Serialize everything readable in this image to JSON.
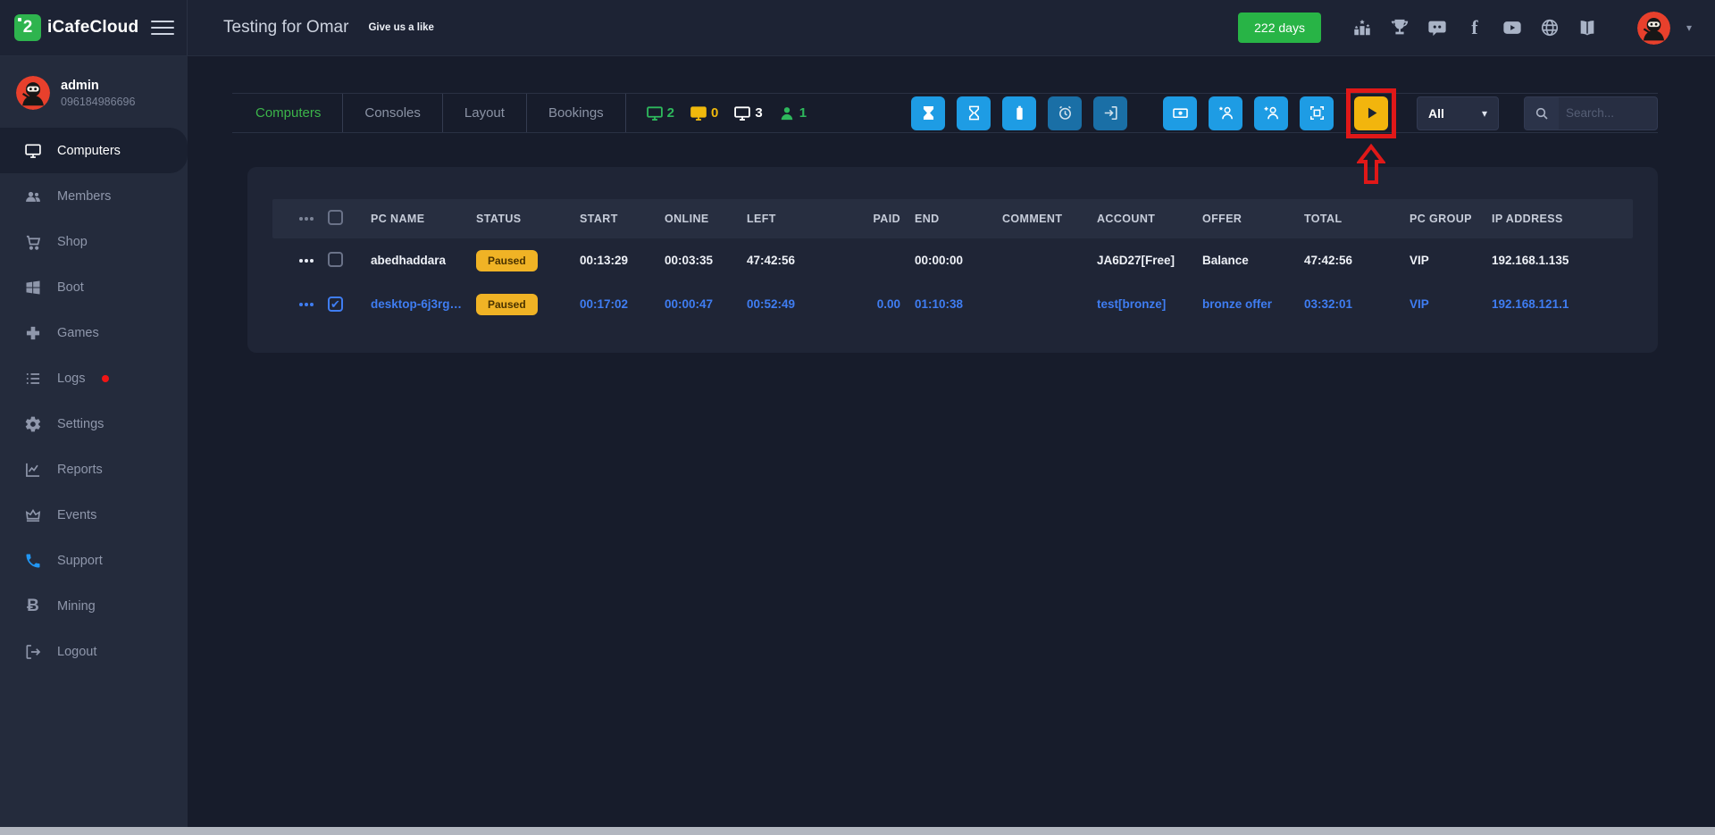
{
  "app": {
    "logo_text": "iCafeCloud",
    "logo_glyph": "2",
    "header_title": "Testing for Omar",
    "like_text": "Give us a like",
    "days_badge": "222 days",
    "social_icons": [
      "ranking",
      "trophy",
      "discord",
      "facebook",
      "youtube",
      "website",
      "docs"
    ]
  },
  "user": {
    "name": "admin",
    "phone": "096184986696"
  },
  "sidebar": {
    "items": [
      {
        "label": "Computers",
        "icon": "monitor",
        "active": true
      },
      {
        "label": "Members",
        "icon": "people",
        "active": false
      },
      {
        "label": "Shop",
        "icon": "cart",
        "active": false
      },
      {
        "label": "Boot",
        "icon": "windows",
        "active": false
      },
      {
        "label": "Games",
        "icon": "gamepad",
        "active": false
      },
      {
        "label": "Logs",
        "icon": "list",
        "active": false,
        "alert_dot": true
      },
      {
        "label": "Settings",
        "icon": "gear",
        "active": false
      },
      {
        "label": "Reports",
        "icon": "chart",
        "active": false
      },
      {
        "label": "Events",
        "icon": "crown",
        "active": false
      },
      {
        "label": "Support",
        "icon": "phone",
        "active": false
      },
      {
        "label": "Mining",
        "icon": "bitcoin",
        "active": false
      },
      {
        "label": "Logout",
        "icon": "logout",
        "active": false
      }
    ],
    "bitcoin_glyph": "Ƀ"
  },
  "toolbar": {
    "tabs": [
      {
        "label": "Computers",
        "active": true
      },
      {
        "label": "Consoles",
        "active": false
      },
      {
        "label": "Layout",
        "active": false
      },
      {
        "label": "Bookings",
        "active": false
      }
    ],
    "counters": [
      {
        "icon": "monitor",
        "value": "2",
        "color": "#2eb85c"
      },
      {
        "icon": "monitor",
        "value": "0",
        "color": "#f0b90c"
      },
      {
        "icon": "monitor",
        "value": "3",
        "color": "#ffffff"
      },
      {
        "icon": "person",
        "value": "1",
        "color": "#2eb85c"
      }
    ],
    "actions": [
      "hourglass-filled",
      "hourglass-outline",
      "battery",
      "alarm-clock",
      "sign-out",
      "cash",
      "member-star",
      "member-add",
      "screenshot",
      "start-play"
    ],
    "filter_value": "All",
    "search_placeholder": "Search..."
  },
  "table": {
    "columns": [
      "PC NAME",
      "STATUS",
      "START",
      "ONLINE",
      "LEFT",
      "PAID",
      "END",
      "COMMENT",
      "ACCOUNT",
      "OFFER",
      "TOTAL",
      "PC GROUP",
      "IP ADDRESS"
    ],
    "rows": [
      {
        "pc_name": "abedhaddara",
        "status": "Paused",
        "start": "00:13:29",
        "online": "00:03:35",
        "left": "47:42:56",
        "paid": "",
        "end": "00:00:00",
        "comment": "",
        "account": "JA6D27[Free]",
        "offer": "Balance",
        "total": "47:42:56",
        "pc_group": "VIP",
        "ip": "192.168.1.135",
        "checked": false,
        "highlighted": false
      },
      {
        "pc_name": "desktop-6j3rg…",
        "status": "Paused",
        "start": "00:17:02",
        "online": "00:00:47",
        "left": "00:52:49",
        "paid": "0.00",
        "end": "01:10:38",
        "comment": "",
        "account": "test[bronze]",
        "offer": "bronze offer",
        "total": "03:32:01",
        "pc_group": "VIP",
        "ip": "192.168.121.1",
        "checked": true,
        "highlighted": true
      }
    ]
  },
  "check_glyph": "✔",
  "colors": {
    "accent_green": "#28b446",
    "accent_blue": "#1e9ce4",
    "accent_yellow": "#f2b50d",
    "badge_paused": "#f0b325",
    "row_highlight": "#3f7df2",
    "annotation_red": "#e01818"
  }
}
